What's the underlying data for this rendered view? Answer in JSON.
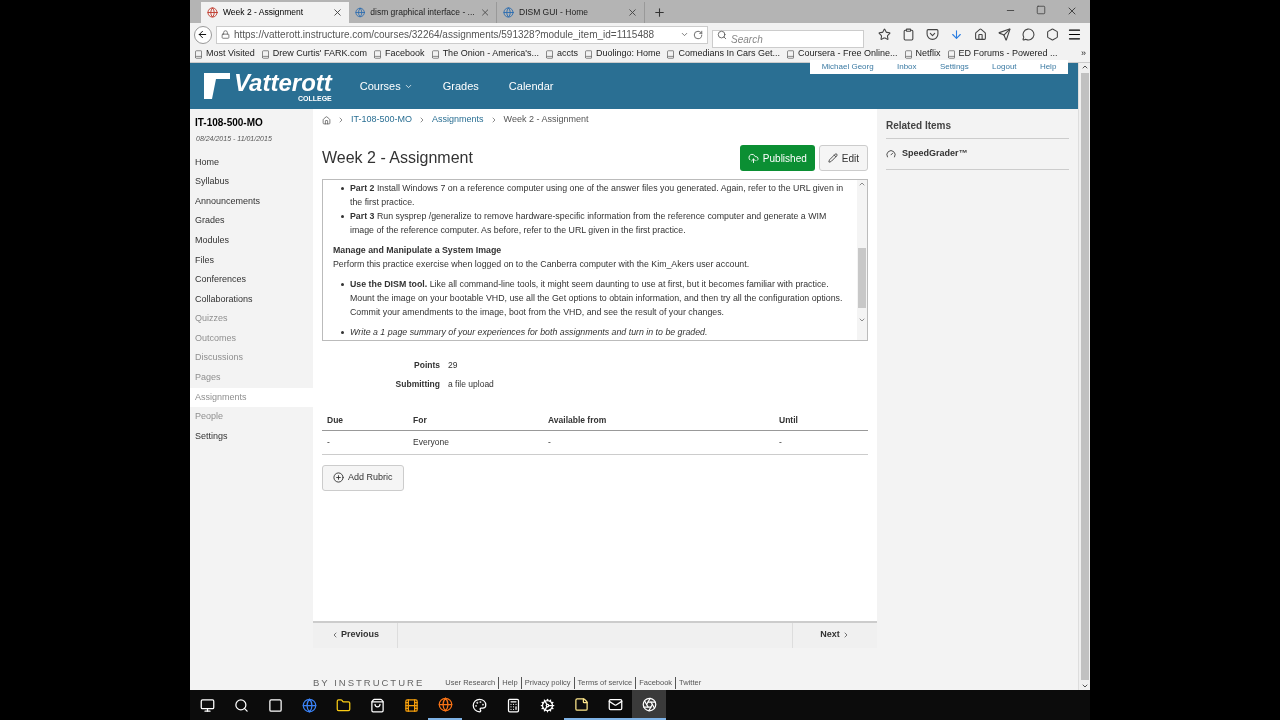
{
  "browser": {
    "tabs": [
      {
        "title": "Week 2 - Assignment",
        "selected": true
      },
      {
        "title": "dism graphical interface - ...",
        "selected": false
      },
      {
        "title": "DISM GUI - Home",
        "selected": false
      }
    ],
    "url": "https://vatterott.instructure.com/courses/32264/assignments/591328?module_item_id=1115488",
    "search": {
      "placeholder": "Search"
    },
    "bookmarks": [
      "Most Visited",
      "Drew Curtis' FARK.com",
      "Facebook",
      "The Onion - America's...",
      "accts",
      "Duolingo: Home",
      "Comedians In Cars Get...",
      "Coursera - Free Online...",
      "Netflix",
      "ED Forums - Powered ..."
    ],
    "bookmarks_more": "»"
  },
  "header": {
    "logo": {
      "name": "Vatterott",
      "sub": "COLLEGE"
    },
    "nav": [
      "Courses",
      "Grades",
      "Calendar"
    ],
    "user_menu": [
      "Michael Georg",
      "Inbox",
      "Settings",
      "Logout",
      "Help"
    ]
  },
  "sidebar": {
    "course": "IT-108-500-MO",
    "dates": "08/24/2015 - 11/01/2015",
    "items": [
      {
        "label": "Home",
        "disabled": false,
        "selected": false
      },
      {
        "label": "Syllabus",
        "disabled": false,
        "selected": false
      },
      {
        "label": "Announcements",
        "disabled": false,
        "selected": false
      },
      {
        "label": "Grades",
        "disabled": false,
        "selected": false
      },
      {
        "label": "Modules",
        "disabled": false,
        "selected": false
      },
      {
        "label": "Files",
        "disabled": false,
        "selected": false
      },
      {
        "label": "Conferences",
        "disabled": false,
        "selected": false
      },
      {
        "label": "Collaborations",
        "disabled": false,
        "selected": false
      },
      {
        "label": "Quizzes",
        "disabled": true,
        "selected": false
      },
      {
        "label": "Outcomes",
        "disabled": true,
        "selected": false
      },
      {
        "label": "Discussions",
        "disabled": true,
        "selected": false
      },
      {
        "label": "Pages",
        "disabled": true,
        "selected": false
      },
      {
        "label": "Assignments",
        "disabled": true,
        "selected": true
      },
      {
        "label": "People",
        "disabled": true,
        "selected": false
      },
      {
        "label": "Settings",
        "disabled": false,
        "selected": false
      }
    ]
  },
  "breadcrumbs": [
    "IT-108-500-MO",
    "Assignments",
    "Week 2 - Assignment"
  ],
  "title": "Week 2 - Assignment",
  "published_button": "Published",
  "edit_button": "Edit",
  "description": [
    {
      "kind": "bullet",
      "text": "**Part 2** Install Windows 7 on a reference computer using one of the answer files you generated. Again, refer to the URL given in the first practice."
    },
    {
      "kind": "bullet",
      "text": "**Part 3** Run sysprep /generalize to remove hardware-specific information from the reference computer and generate a WIM image of the reference computer. As before, refer to the URL given in the first practice."
    },
    {
      "kind": "heading",
      "text": "Manage and Manipulate a System Image"
    },
    {
      "kind": "paragraph",
      "text": "Perform this practice exercise when logged on to the Canberra computer with the Kim_Akers user account."
    },
    {
      "kind": "bullet",
      "text": "**Use the DISM tool.** Like all command-line tools, it might seem daunting to use at first, but it becomes familiar with practice. Mount the image on your bootable VHD, use all the Get options to obtain information, and then try all the configuration options. Commit your amendments to the image, boot from the VHD, and see the result of your changes."
    },
    {
      "kind": "bullet",
      "text": "*Write a 1 page summary of your experiences for both assignments and turn in to be graded.*"
    }
  ],
  "details": [
    {
      "label": "Points",
      "value": "29"
    },
    {
      "label": "Submitting",
      "value": "a file upload"
    }
  ],
  "table": {
    "columns": [
      "Due",
      "For",
      "Available from",
      "Until"
    ],
    "rows": [
      [
        "-",
        "Everyone",
        "-",
        "-"
      ]
    ]
  },
  "add_rubric": "Add Rubric",
  "related": {
    "title": "Related Items",
    "items": [
      "SpeedGrader™"
    ]
  },
  "pager": {
    "previous": "Previous",
    "next": "Next"
  },
  "footer": {
    "brand": "BY INSTRUCTURE",
    "links": [
      "User Research",
      "Help",
      "Privacy policy",
      "Terms of service",
      "Facebook",
      "Twitter"
    ]
  },
  "taskbar": [
    {
      "kind": "start",
      "running": false,
      "selected": false
    },
    {
      "kind": "search",
      "running": false,
      "selected": false
    },
    {
      "kind": "taskview",
      "running": false,
      "selected": false
    },
    {
      "kind": "edge",
      "running": false,
      "selected": false
    },
    {
      "kind": "explorer",
      "running": false,
      "selected": false
    },
    {
      "kind": "store",
      "running": false,
      "selected": false
    },
    {
      "kind": "media",
      "running": false,
      "selected": false
    },
    {
      "kind": "firefox",
      "running": true,
      "selected": false
    },
    {
      "kind": "paint",
      "running": false,
      "selected": false
    },
    {
      "kind": "calculator",
      "running": false,
      "selected": false
    },
    {
      "kind": "steam",
      "running": false,
      "selected": false
    },
    {
      "kind": "notes",
      "running": true,
      "selected": false
    },
    {
      "kind": "mail",
      "running": true,
      "selected": false
    },
    {
      "kind": "obs",
      "running": true,
      "selected": true
    }
  ]
}
